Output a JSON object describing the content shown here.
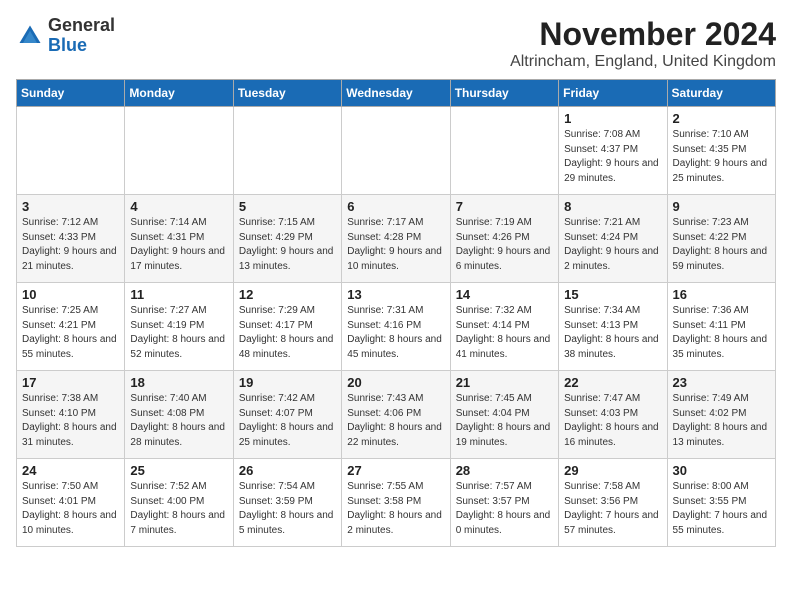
{
  "header": {
    "logo_line1": "General",
    "logo_line2": "Blue",
    "month_title": "November 2024",
    "location": "Altrincham, England, United Kingdom"
  },
  "days_of_week": [
    "Sunday",
    "Monday",
    "Tuesday",
    "Wednesday",
    "Thursday",
    "Friday",
    "Saturday"
  ],
  "weeks": [
    [
      {
        "num": "",
        "info": ""
      },
      {
        "num": "",
        "info": ""
      },
      {
        "num": "",
        "info": ""
      },
      {
        "num": "",
        "info": ""
      },
      {
        "num": "",
        "info": ""
      },
      {
        "num": "1",
        "info": "Sunrise: 7:08 AM\nSunset: 4:37 PM\nDaylight: 9 hours\nand 29 minutes."
      },
      {
        "num": "2",
        "info": "Sunrise: 7:10 AM\nSunset: 4:35 PM\nDaylight: 9 hours\nand 25 minutes."
      }
    ],
    [
      {
        "num": "3",
        "info": "Sunrise: 7:12 AM\nSunset: 4:33 PM\nDaylight: 9 hours\nand 21 minutes."
      },
      {
        "num": "4",
        "info": "Sunrise: 7:14 AM\nSunset: 4:31 PM\nDaylight: 9 hours\nand 17 minutes."
      },
      {
        "num": "5",
        "info": "Sunrise: 7:15 AM\nSunset: 4:29 PM\nDaylight: 9 hours\nand 13 minutes."
      },
      {
        "num": "6",
        "info": "Sunrise: 7:17 AM\nSunset: 4:28 PM\nDaylight: 9 hours\nand 10 minutes."
      },
      {
        "num": "7",
        "info": "Sunrise: 7:19 AM\nSunset: 4:26 PM\nDaylight: 9 hours\nand 6 minutes."
      },
      {
        "num": "8",
        "info": "Sunrise: 7:21 AM\nSunset: 4:24 PM\nDaylight: 9 hours\nand 2 minutes."
      },
      {
        "num": "9",
        "info": "Sunrise: 7:23 AM\nSunset: 4:22 PM\nDaylight: 8 hours\nand 59 minutes."
      }
    ],
    [
      {
        "num": "10",
        "info": "Sunrise: 7:25 AM\nSunset: 4:21 PM\nDaylight: 8 hours\nand 55 minutes."
      },
      {
        "num": "11",
        "info": "Sunrise: 7:27 AM\nSunset: 4:19 PM\nDaylight: 8 hours\nand 52 minutes."
      },
      {
        "num": "12",
        "info": "Sunrise: 7:29 AM\nSunset: 4:17 PM\nDaylight: 8 hours\nand 48 minutes."
      },
      {
        "num": "13",
        "info": "Sunrise: 7:31 AM\nSunset: 4:16 PM\nDaylight: 8 hours\nand 45 minutes."
      },
      {
        "num": "14",
        "info": "Sunrise: 7:32 AM\nSunset: 4:14 PM\nDaylight: 8 hours\nand 41 minutes."
      },
      {
        "num": "15",
        "info": "Sunrise: 7:34 AM\nSunset: 4:13 PM\nDaylight: 8 hours\nand 38 minutes."
      },
      {
        "num": "16",
        "info": "Sunrise: 7:36 AM\nSunset: 4:11 PM\nDaylight: 8 hours\nand 35 minutes."
      }
    ],
    [
      {
        "num": "17",
        "info": "Sunrise: 7:38 AM\nSunset: 4:10 PM\nDaylight: 8 hours\nand 31 minutes."
      },
      {
        "num": "18",
        "info": "Sunrise: 7:40 AM\nSunset: 4:08 PM\nDaylight: 8 hours\nand 28 minutes."
      },
      {
        "num": "19",
        "info": "Sunrise: 7:42 AM\nSunset: 4:07 PM\nDaylight: 8 hours\nand 25 minutes."
      },
      {
        "num": "20",
        "info": "Sunrise: 7:43 AM\nSunset: 4:06 PM\nDaylight: 8 hours\nand 22 minutes."
      },
      {
        "num": "21",
        "info": "Sunrise: 7:45 AM\nSunset: 4:04 PM\nDaylight: 8 hours\nand 19 minutes."
      },
      {
        "num": "22",
        "info": "Sunrise: 7:47 AM\nSunset: 4:03 PM\nDaylight: 8 hours\nand 16 minutes."
      },
      {
        "num": "23",
        "info": "Sunrise: 7:49 AM\nSunset: 4:02 PM\nDaylight: 8 hours\nand 13 minutes."
      }
    ],
    [
      {
        "num": "24",
        "info": "Sunrise: 7:50 AM\nSunset: 4:01 PM\nDaylight: 8 hours\nand 10 minutes."
      },
      {
        "num": "25",
        "info": "Sunrise: 7:52 AM\nSunset: 4:00 PM\nDaylight: 8 hours\nand 7 minutes."
      },
      {
        "num": "26",
        "info": "Sunrise: 7:54 AM\nSunset: 3:59 PM\nDaylight: 8 hours\nand 5 minutes."
      },
      {
        "num": "27",
        "info": "Sunrise: 7:55 AM\nSunset: 3:58 PM\nDaylight: 8 hours\nand 2 minutes."
      },
      {
        "num": "28",
        "info": "Sunrise: 7:57 AM\nSunset: 3:57 PM\nDaylight: 8 hours\nand 0 minutes."
      },
      {
        "num": "29",
        "info": "Sunrise: 7:58 AM\nSunset: 3:56 PM\nDaylight: 7 hours\nand 57 minutes."
      },
      {
        "num": "30",
        "info": "Sunrise: 8:00 AM\nSunset: 3:55 PM\nDaylight: 7 hours\nand 55 minutes."
      }
    ]
  ]
}
